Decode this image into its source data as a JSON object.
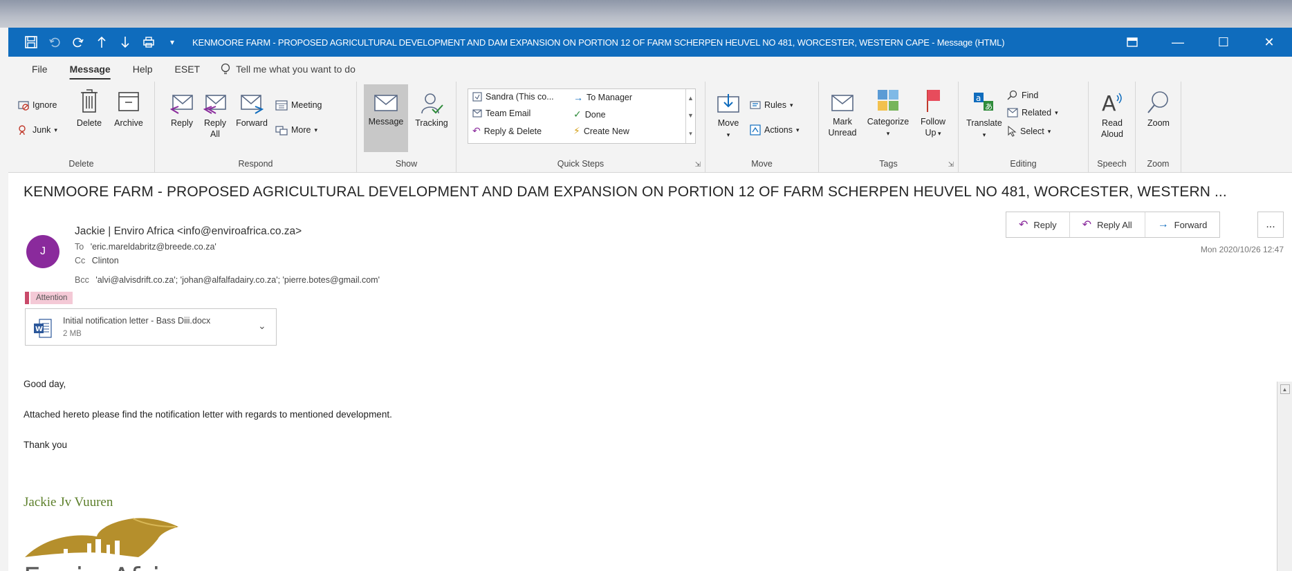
{
  "window": {
    "title": "KENMOORE FARM - PROPOSED AGRICULTURAL DEVELOPMENT AND DAM EXPANSION ON PORTION 12 OF FARM SCHERPEN HEUVEL NO 481, WORCESTER, WESTERN CAPE  -  Message (HTML)"
  },
  "menu": {
    "tabs": [
      "File",
      "Message",
      "Help",
      "ESET"
    ],
    "active_tab": "Message",
    "tell_me": "Tell me what you want to do"
  },
  "ribbon": {
    "delete_group": {
      "ignore": "Ignore",
      "junk": "Junk",
      "delete": "Delete",
      "archive": "Archive",
      "label": "Delete"
    },
    "respond_group": {
      "reply": "Reply",
      "reply_all_1": "Reply",
      "reply_all_2": "All",
      "forward": "Forward",
      "meeting": "Meeting",
      "more": "More",
      "label": "Respond"
    },
    "show_group": {
      "message": "Message",
      "tracking": "Tracking",
      "label": "Show"
    },
    "quick_steps": {
      "items": [
        "Sandra (This co...",
        "Team Email",
        "Reply & Delete",
        "To Manager",
        "Done",
        "Create New"
      ],
      "label": "Quick Steps"
    },
    "move_group": {
      "move": "Move",
      "rules": "Rules",
      "actions": "Actions",
      "label": "Move"
    },
    "tags_group": {
      "mark_unread_1": "Mark",
      "mark_unread_2": "Unread",
      "categorize": "Categorize",
      "follow_up_1": "Follow",
      "follow_up_2": "Up",
      "label": "Tags"
    },
    "editing_group": {
      "translate": "Translate",
      "find": "Find",
      "related": "Related",
      "select": "Select",
      "label": "Editing"
    },
    "speech_group": {
      "read_aloud_1": "Read",
      "read_aloud_2": "Aloud",
      "label": "Speech"
    },
    "zoom_group": {
      "zoom": "Zoom",
      "label": "Zoom"
    }
  },
  "message": {
    "subject": "KENMOORE FARM - PROPOSED AGRICULTURAL DEVELOPMENT AND DAM EXPANSION ON PORTION 12 OF FARM SCHERPEN HEUVEL NO 481, WORCESTER, WESTERN ...",
    "avatar_initial": "J",
    "sender": "Jackie | Enviro Africa <info@enviroafrica.co.za>",
    "to_label": "To",
    "to": "'eric.mareldabritz@breede.co.za'",
    "cc_label": "Cc",
    "cc": "Clinton",
    "bcc_label": "Bcc",
    "bcc": "'alvi@alvisdrift.co.za'; 'johan@alfalfadairy.co.za'; 'pierre.botes@gmail.com'",
    "date": "Mon 2020/10/26 12:47",
    "category": "Attention",
    "actions": {
      "reply": "Reply",
      "reply_all": "Reply All",
      "forward": "Forward",
      "more": "..."
    },
    "attachment": {
      "name": "Initial notification letter - Bass Diii.docx",
      "size": "2 MB"
    },
    "body": [
      "Good day,",
      "Attached hereto please find the notification letter with regards to mentioned development.",
      "Thank you"
    ],
    "signature_name": "Jackie Jv Vuuren",
    "logo_text": "EnviroAfrica"
  },
  "colors": {
    "titlebar": "#0f6cbd",
    "avatar": "#8a2a9c",
    "category": "#f4c9d6",
    "logo_gold": "#b58f2c",
    "signature": "#5c7f2a"
  }
}
